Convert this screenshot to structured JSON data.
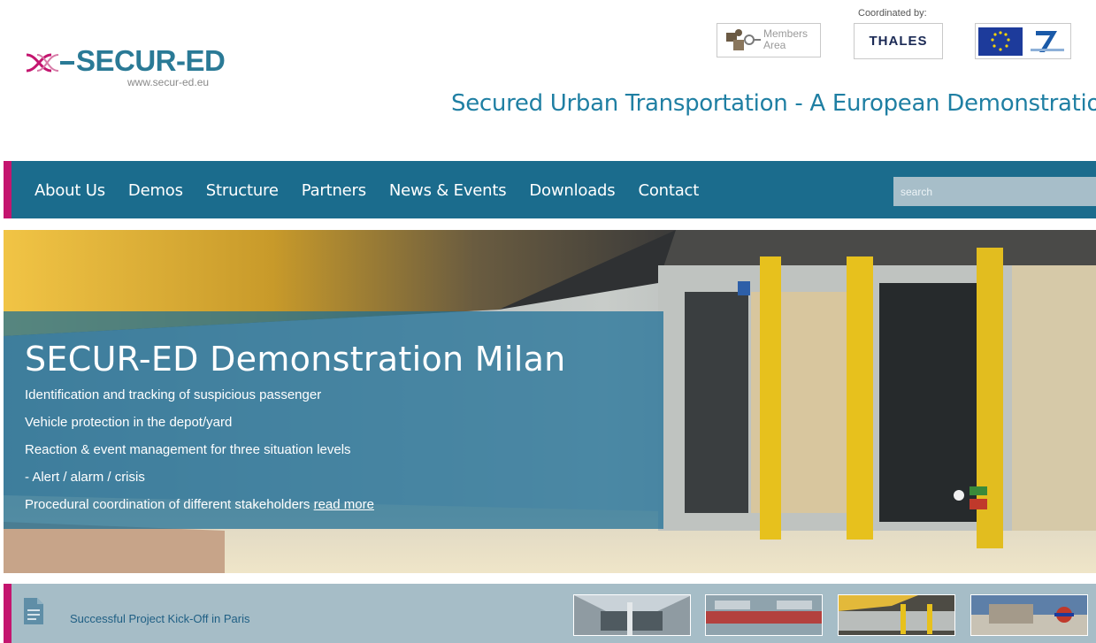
{
  "header": {
    "logo_text": "SECUR-ED",
    "logo_url": "www.secur-ed.eu",
    "members_area": [
      "Members",
      "Area"
    ],
    "coordinated_by": "Coordinated by:",
    "thales": "THALES",
    "tagline": "Secured Urban Transportation - A European Demonstration"
  },
  "nav": {
    "items": [
      "About Us",
      "Demos",
      "Structure",
      "Partners",
      "News & Events",
      "Downloads",
      "Contact"
    ],
    "search_placeholder": "search"
  },
  "hero": {
    "title": "SECUR-ED Demonstration Milan",
    "lines": [
      "Identification and tracking of suspicious passenger",
      "Vehicle protection in the depot/yard",
      "Reaction & event management for three situation levels",
      "- Alert / alarm / crisis",
      "Procedural coordination of different stakeholders"
    ],
    "read_more": "read more"
  },
  "news": {
    "headline": "Successful Project Kick-Off in Paris"
  },
  "colors": {
    "nav_bg": "#1b6c8d",
    "accent": "#c4156f",
    "tagline": "#1f7fa3",
    "bar_bg": "#a6bdc7"
  }
}
